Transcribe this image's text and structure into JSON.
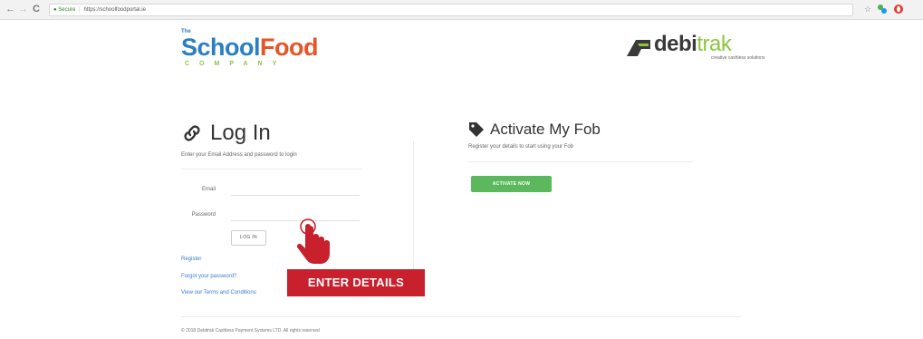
{
  "browser": {
    "back_icon": "←",
    "forward_icon": "→",
    "reload_icon": "C",
    "secure_label": "Secure",
    "url": "https://schoolfoodportal.ie",
    "star_icon": "☆"
  },
  "logos": {
    "school_food": {
      "the": "The",
      "school": "School",
      "food": "Food",
      "company": "COMPANY"
    },
    "debitrak": {
      "debi": "debi",
      "trak": "trak",
      "tagline": "creative cashless solutions"
    }
  },
  "login": {
    "title": "Log In",
    "subtitle": "Enter your Email Address and password to login",
    "email_label": "Email",
    "email_value": "",
    "password_label": "Password",
    "password_value": "",
    "button_label": "LOG IN",
    "links": {
      "register": "Register",
      "forgot": "Forgot your password?",
      "terms": "View our Terms and Conditions"
    }
  },
  "activate": {
    "title": "Activate My Fob",
    "subtitle": "Register your details to start using your Fob",
    "button_label": "ACTIVATE NOW"
  },
  "overlay": {
    "banner": "ENTER DETAILS"
  },
  "footer": {
    "copyright": "© 2018 Debitrak Cashless Payment Systems LTD. All rights reserved"
  },
  "colors": {
    "brand_red": "#c8202c",
    "activate_green": "#5cb85c",
    "link_blue": "#3a7bd5",
    "school_blue": "#2a7fc2",
    "food_orange": "#e65528",
    "company_green": "#8bc34a"
  }
}
